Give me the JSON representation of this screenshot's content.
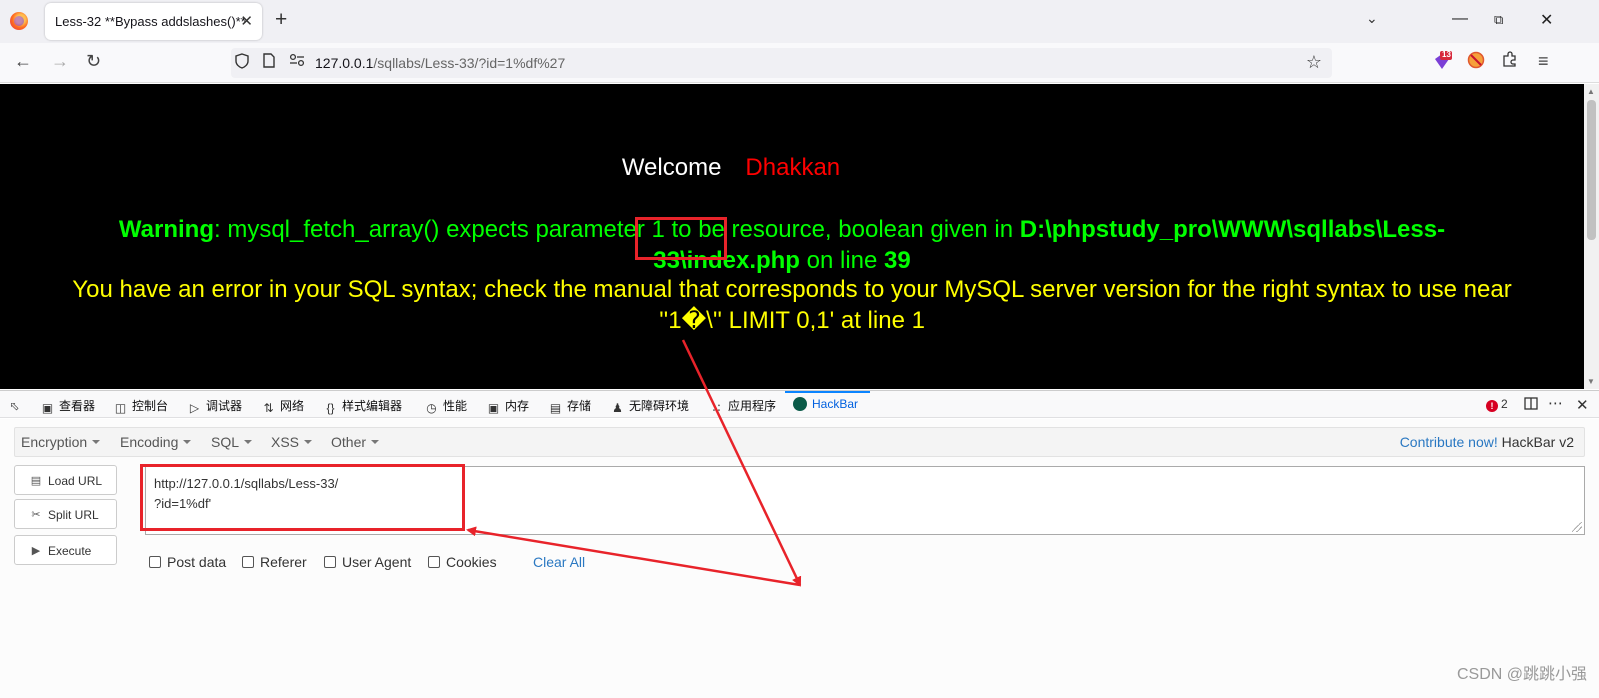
{
  "browser": {
    "tab_title": "Less-32 **Bypass addslashes()**",
    "url_host": "127.0.0.1",
    "url_path": "/sqllabs/Less-33/?id=1%df%27",
    "extension_badge": "13"
  },
  "page": {
    "welcome": "Welcome",
    "name": "Dhakkan",
    "warning_label": "Warning",
    "warning_text": ": mysql_fetch_array() expects parameter 1 to be resource, boolean given in ",
    "warning_path_1": "D:\\phpstudy_pro\\WWW\\sqllabs\\Less-",
    "warning_path_2": "33\\index.php",
    "warning_online": " on line ",
    "warning_line": "39",
    "sql_error_1": "You have an error in your SQL syntax; check the manual that corresponds to your MySQL server version for the right syntax to use near",
    "sql_error_2": "''1�\\'' LIMIT 0,1' at line 1",
    "colors": {
      "background": "#000000",
      "warning": "#00ff00",
      "sql_error": "#ffff00",
      "name": "#ff0000"
    }
  },
  "devtools": {
    "tabs": [
      "查看器",
      "控制台",
      "调试器",
      "网络",
      "样式编辑器",
      "性能",
      "内存",
      "存储",
      "无障碍环境",
      "应用程序",
      "HackBar"
    ],
    "active_tab": "HackBar",
    "error_count": "2"
  },
  "hackbar": {
    "menu": [
      "Encryption",
      "Encoding",
      "SQL",
      "XSS",
      "Other"
    ],
    "contribute": "Contribute now!",
    "version": "HackBar v2",
    "buttons": [
      "Load URL",
      "Split URL",
      "Execute"
    ],
    "url_lines": [
      "http://127.0.0.1/sqllabs/Less-33/",
      "?id=1%df'"
    ],
    "checkboxes": [
      "Post data",
      "Referer",
      "User Agent",
      "Cookies"
    ],
    "clear_all": "Clear All"
  },
  "watermark": "CSDN @跳跳小强",
  "annotation_color": "#e8232a"
}
